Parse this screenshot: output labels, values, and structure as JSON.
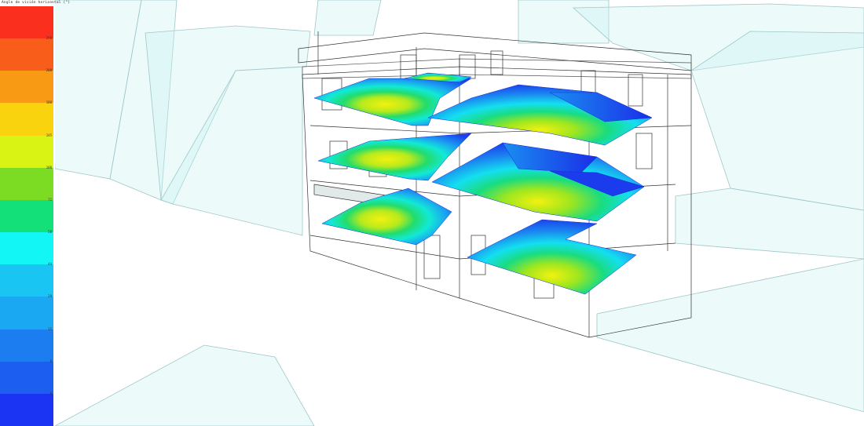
{
  "legend": {
    "title": "Angle de visión horizontal (°)",
    "colors": [
      "#fa2f1e",
      "#f95d1a",
      "#f99a14",
      "#f9d40e",
      "#d9f414",
      "#7cdc24",
      "#14e07a",
      "#12f7f5",
      "#19c6f3",
      "#1aa8f2",
      "#1c7df0",
      "#1c5ef0",
      "#1b33f2"
    ],
    "ticks": [
      "250",
      "208",
      "180",
      "145",
      "108",
      "72",
      "58",
      "44",
      "29",
      "15",
      "8",
      "0"
    ]
  }
}
